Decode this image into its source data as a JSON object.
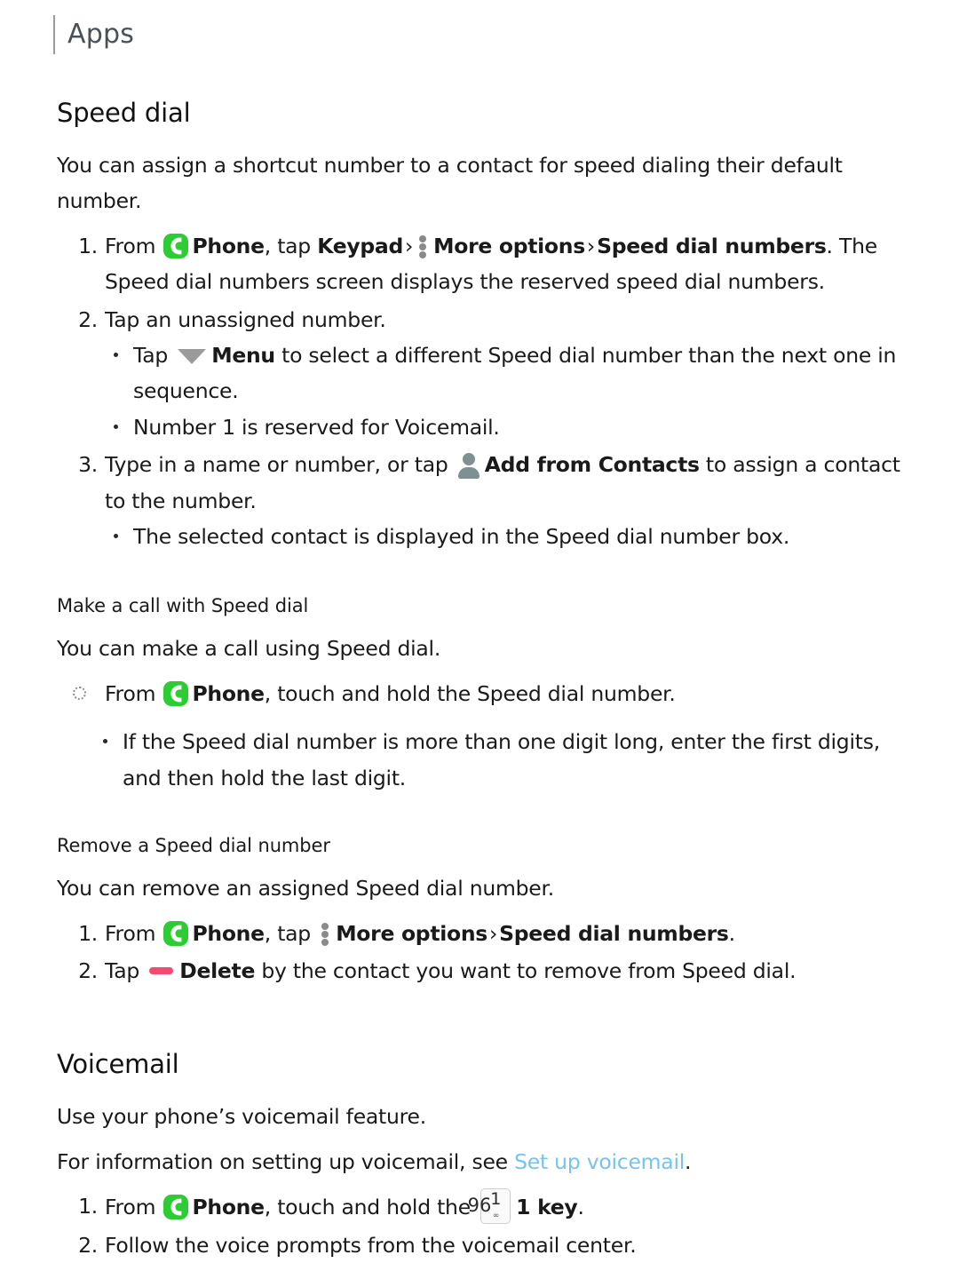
{
  "header": {
    "title": "Apps"
  },
  "speed_dial": {
    "heading": "Speed dial",
    "intro": "You can assign a shortcut number to a contact for speed dialing their default number.",
    "steps": [
      {
        "num": "1.",
        "t1": "From",
        "phone_label": "Phone",
        "t2": ", tap",
        "keypad_label": "Keypad",
        "chev1": "›",
        "more_options_label": "More options",
        "chev2": "›",
        "speed_dial_numbers_label": "Speed dial numbers",
        "t3": ". The Speed dial numbers screen displays the reserved speed dial numbers."
      },
      {
        "num": "2.",
        "text": "Tap an unassigned number.",
        "bullets": [
          {
            "t1": "Tap",
            "menu_label": "Menu",
            "t2": "to select a different Speed dial number than the next one in sequence."
          },
          {
            "text": "Number 1 is reserved for Voicemail."
          }
        ]
      },
      {
        "num": "3.",
        "t1": "Type in a name or number, or tap",
        "add_from_contacts_label": "Add from Contacts",
        "t2": "to assign a contact to the number.",
        "bullets": [
          {
            "text": "The selected contact is displayed in the Speed dial number box."
          }
        ]
      }
    ]
  },
  "make_a_call": {
    "heading": "Make a call with Speed dial",
    "intro": "You can make a call using Speed dial.",
    "action": {
      "t1": "From",
      "phone_label": "Phone",
      "t2": ", touch and hold the Speed dial number."
    },
    "bullets": [
      {
        "text": "If the Speed dial number is more than one digit long, enter the first digits, and then hold the last digit."
      }
    ]
  },
  "remove_speed_dial": {
    "heading": "Remove a Speed dial number",
    "intro": "You can remove an assigned Speed dial number.",
    "steps": [
      {
        "num": "1.",
        "t1": "From",
        "phone_label": "Phone",
        "t2": ", tap",
        "more_options_label": "More options",
        "chev": "›",
        "speed_dial_numbers_label": "Speed dial numbers",
        "t3": "."
      },
      {
        "num": "2.",
        "t1": "Tap",
        "delete_label": "Delete",
        "t2": "by the contact you want to remove from Speed dial."
      }
    ]
  },
  "voicemail": {
    "heading": "Voicemail",
    "intro": "Use your phone’s voicemail feature.",
    "link_sentence_before": "For information on setting up voicemail, see ",
    "link_text": "Set up voicemail",
    "link_sentence_after": ".",
    "steps": [
      {
        "num": "1.",
        "t1": "From",
        "phone_label": "Phone",
        "t2": ", touch and hold the",
        "key_digit": "1",
        "key_vm_glyph": "∞",
        "key_label": "1 key",
        "t3": "."
      },
      {
        "num": "2.",
        "text": "Follow the voice prompts from the voicemail center."
      }
    ]
  },
  "footer": {
    "page_number": "96"
  },
  "colors": {
    "phone_icon_green": "#2ecc34",
    "delete_icon_pink": "#f44a72",
    "link_blue": "#76c3ef",
    "contact_icon_gray": "#7e9091",
    "menu_caret_gray": "#9b9b9b"
  },
  "icons": {
    "phone": "phone-icon",
    "more_options": "kebab-menu-icon",
    "menu": "caret-down-icon",
    "add_from_contacts": "contact-person-icon",
    "delete": "minus-delete-icon",
    "one_key": "dialpad-one-key-icon"
  }
}
